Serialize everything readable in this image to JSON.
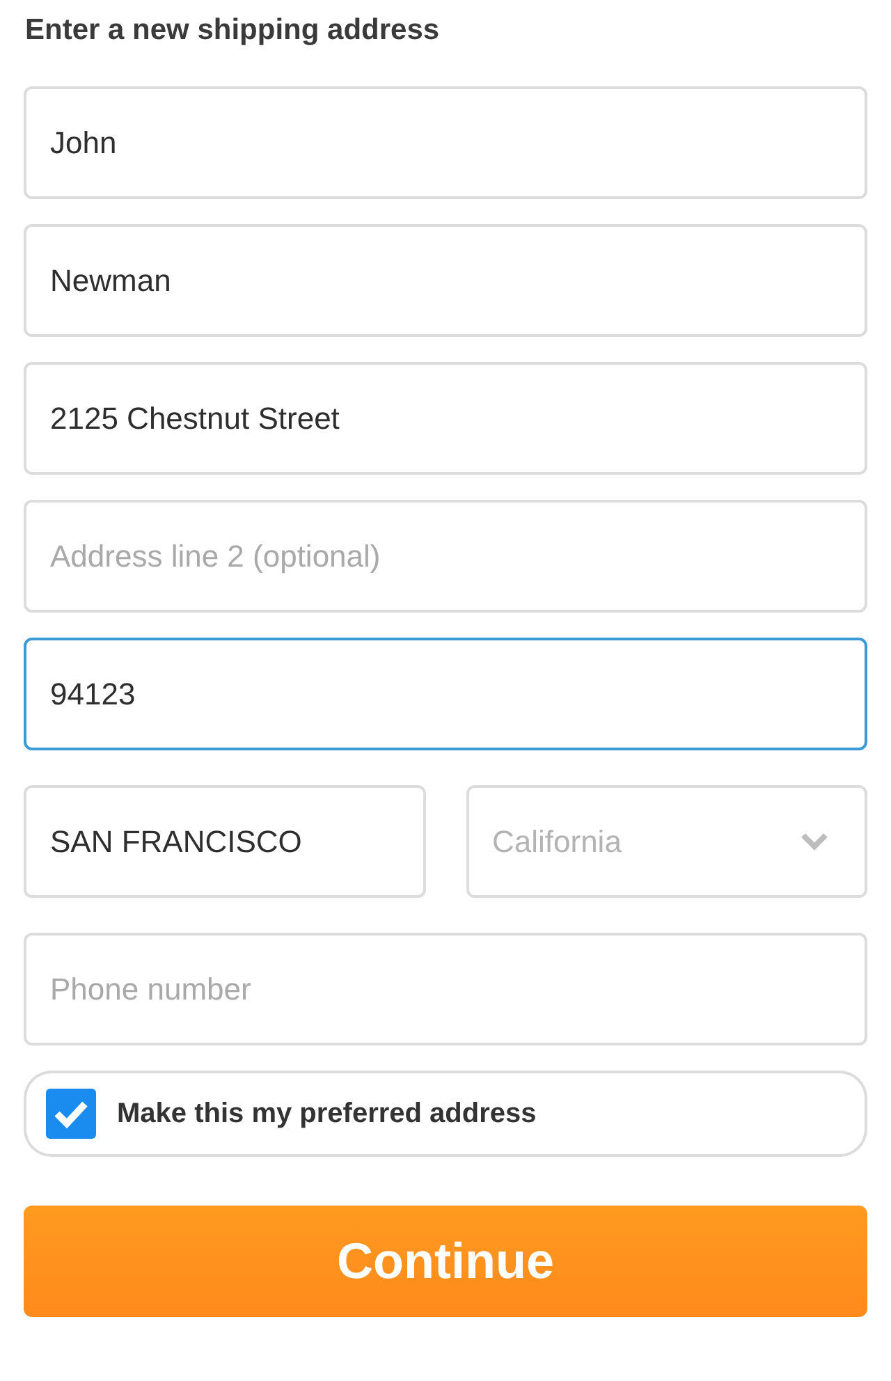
{
  "heading": "Enter a new shipping address",
  "rows": [
    {
      "fields": [
        {
          "kind": "text",
          "value": "John",
          "focused": false
        }
      ]
    },
    {
      "fields": [
        {
          "kind": "text",
          "value": "Newman",
          "focused": false
        }
      ]
    },
    {
      "fields": [
        {
          "kind": "text",
          "value": "2125 Chestnut Street",
          "focused": false
        }
      ]
    },
    {
      "fields": [
        {
          "kind": "text",
          "placeholder": "Address line 2 (optional)",
          "focused": false
        }
      ]
    },
    {
      "fields": [
        {
          "kind": "text",
          "value": "94123",
          "focused": true
        }
      ]
    },
    {
      "fields": [
        {
          "kind": "text",
          "value": "SAN FRANCISCO",
          "focused": false
        },
        {
          "kind": "select",
          "placeholder": "California",
          "focused": false
        }
      ]
    },
    {
      "fields": [
        {
          "kind": "text",
          "placeholder": "Phone number",
          "focused": false
        }
      ]
    }
  ],
  "preferred": {
    "label": "Make this my preferred address",
    "checked": true
  },
  "continue_button": {
    "label": "Continue"
  }
}
